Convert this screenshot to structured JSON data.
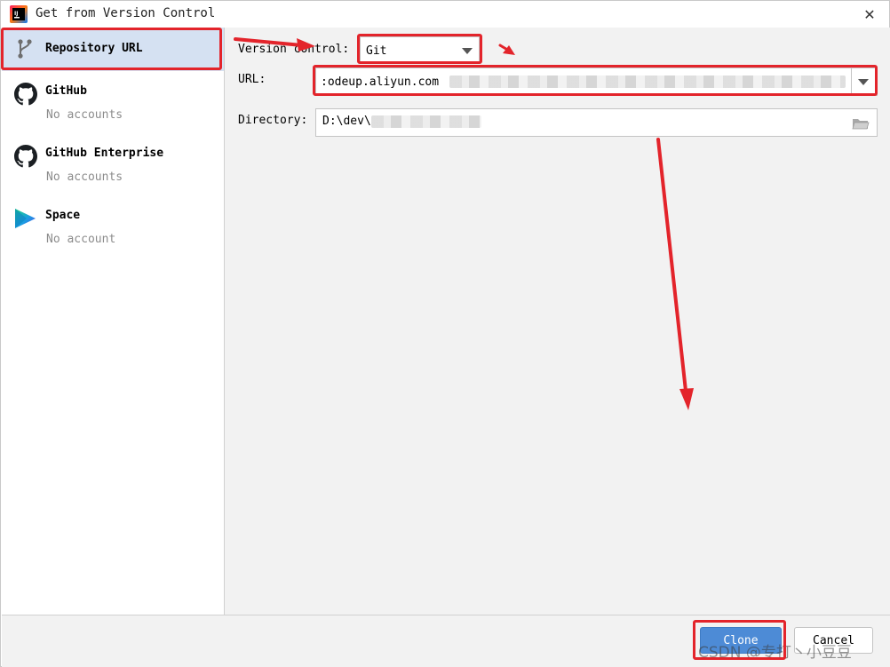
{
  "window": {
    "title": "Get from Version Control",
    "app_icon": "intellij-idea-icon",
    "close_icon": "close-icon"
  },
  "sidebar": {
    "items": [
      {
        "title": "Repository URL",
        "subtitle": "",
        "icon": "branch-icon",
        "selected": true
      },
      {
        "title": "GitHub",
        "subtitle": "No accounts",
        "icon": "github-icon",
        "selected": false
      },
      {
        "title": "GitHub Enterprise",
        "subtitle": "No accounts",
        "icon": "github-icon",
        "selected": false
      },
      {
        "title": "Space",
        "subtitle": "No account",
        "icon": "space-icon",
        "selected": false
      }
    ]
  },
  "form": {
    "version_control_label": "Version control:",
    "version_control_value": "Git",
    "url_label": "URL:",
    "url_value": ":odeup.aliyun.com",
    "directory_label": "Directory:",
    "directory_value": "D:\\dev\\"
  },
  "buttons": {
    "clone": "Clone",
    "cancel": "Cancel"
  },
  "watermark": "CSDN @专打丶小豆豆",
  "colors": {
    "selected_bg": "#d5e1f2",
    "primary_button": "#4d8bd6",
    "annotation_red": "#e3242b"
  }
}
